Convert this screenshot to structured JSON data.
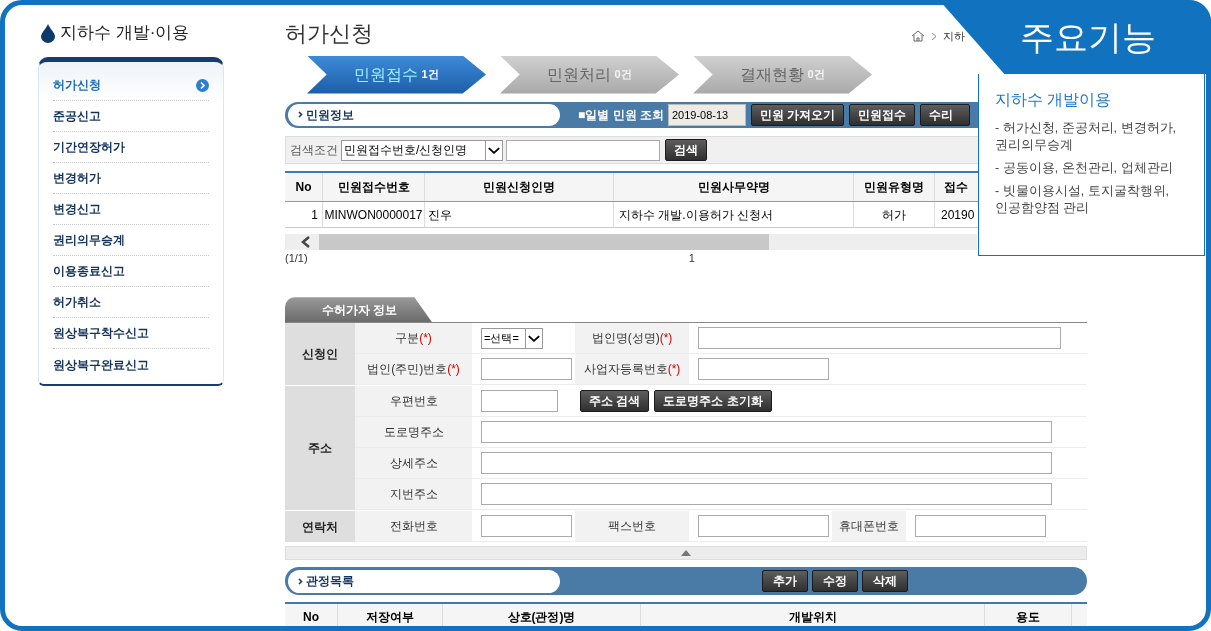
{
  "sidebar": {
    "title": "지하수 개발·이용",
    "items": [
      {
        "label": "허가신청",
        "selected": true
      },
      {
        "label": "준공신고",
        "selected": false
      },
      {
        "label": "기간연장허가",
        "selected": false
      },
      {
        "label": "변경허가",
        "selected": false
      },
      {
        "label": "변경신고",
        "selected": false
      },
      {
        "label": "권리의무승계",
        "selected": false
      },
      {
        "label": "이용종료신고",
        "selected": false
      },
      {
        "label": "허가취소",
        "selected": false
      },
      {
        "label": "원상복구착수신고",
        "selected": false
      },
      {
        "label": "원상복구완료신고",
        "selected": false
      }
    ]
  },
  "page_title": "허가신청",
  "breadcrumb": "지하",
  "steps": [
    {
      "label": "민원접수",
      "count": "1건",
      "selected": true
    },
    {
      "label": "민원처리",
      "count": "0건",
      "selected": false
    },
    {
      "label": "결재현황",
      "count": "0건",
      "selected": false
    }
  ],
  "info_bar": {
    "title": "민원정보",
    "daily": "■일별 민원 조회",
    "date": "2019-08-13",
    "buttons": [
      "민원 가져오기",
      "민원접수",
      "수리"
    ]
  },
  "search": {
    "label": "검색조건",
    "select": "민원접수번호/신청인명",
    "button": "검색"
  },
  "table": {
    "columns": [
      "No",
      "민원접수번호",
      "민원신청인명",
      "민원사무약명",
      "민원유형명",
      "접수"
    ],
    "rows": [
      [
        "1",
        "MINWON0000017",
        "진우",
        "지하수 개발.이용허가 신청서",
        "허가",
        "20190"
      ]
    ]
  },
  "pager": {
    "pages": "(1/1)",
    "current": "1"
  },
  "applicant": {
    "tab": "수허가자 정보",
    "groups": [
      {
        "label": "신청인",
        "rows": [
          [
            {
              "kind": "label",
              "text": "구분",
              "mark": "(*)"
            },
            {
              "kind": "select",
              "value": "=선택="
            },
            {
              "kind": "label",
              "text": "법인명(성명)",
              "mark": "(*)"
            },
            {
              "kind": "longinput"
            }
          ],
          [
            {
              "kind": "label",
              "text": "법인(주민)번호",
              "mark": "(*)"
            },
            {
              "kind": "shortinput"
            },
            {
              "kind": "label",
              "text": "사업자등록번호",
              "mark": "(*)"
            },
            {
              "kind": "input"
            }
          ]
        ]
      },
      {
        "label": "주소",
        "rows": [
          [
            {
              "kind": "label",
              "text": "우편번호"
            },
            {
              "kind": "zipinput"
            },
            {
              "kind": "button",
              "text": "주소 검색"
            },
            {
              "kind": "button",
              "text": "도로명주소 초기화"
            }
          ],
          [
            {
              "kind": "label",
              "text": "도로명주소"
            },
            {
              "kind": "fullinput"
            }
          ],
          [
            {
              "kind": "label",
              "text": "상세주소"
            },
            {
              "kind": "fullinput"
            }
          ],
          [
            {
              "kind": "label",
              "text": "지번주소"
            },
            {
              "kind": "fullinput"
            }
          ]
        ]
      },
      {
        "label": "연락처",
        "rows": [
          [
            {
              "kind": "label",
              "text": "전화번호"
            },
            {
              "kind": "shortinput"
            },
            {
              "kind": "label",
              "text": "팩스번호"
            },
            {
              "kind": "input"
            },
            {
              "kind": "label",
              "text": "휴대폰번호"
            },
            {
              "kind": "input"
            }
          ]
        ]
      }
    ]
  },
  "wells": {
    "title": "관정목록",
    "buttons": [
      "추가",
      "수정",
      "삭제"
    ],
    "columns": [
      "No",
      "저장여부",
      "상호(관정)명",
      "개발위치",
      "용도"
    ]
  },
  "feature_panel": {
    "tab": "주요기능",
    "title": "지하수 개발이용",
    "items": [
      "- 허가신청, 준공처리, 변경허가, 권리의무승계",
      "- 공동이용, 온천관리, 업체관리",
      "- 빗물이용시설, 토지굴착행위, 인공함양점 관리"
    ]
  }
}
